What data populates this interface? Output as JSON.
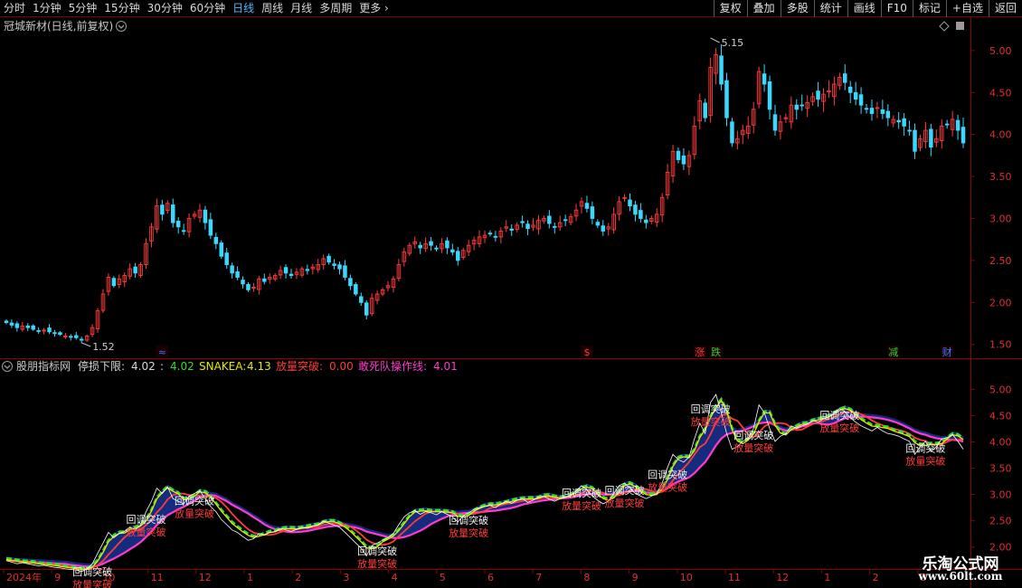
{
  "toolbar": {
    "periods": [
      "分时",
      "1分钟",
      "5分钟",
      "15分钟",
      "30分钟",
      "60分钟",
      "日线",
      "周线",
      "月线",
      "多周期",
      "更多"
    ],
    "active_period": 6,
    "more_arrow": "›",
    "buttons": [
      "复权",
      "叠加",
      "多股",
      "统计",
      "画线",
      "F10",
      "标记",
      "+自选",
      "返回"
    ]
  },
  "main_panel": {
    "title": "冠城新材(日线,前复权)",
    "title_icon": "chevron-down-icon",
    "corner_icons": [
      "diamond-icon",
      "square-icon"
    ],
    "price_ticks": [
      "5.00",
      "4.50",
      "4.00",
      "3.50",
      "3.00",
      "2.50",
      "2.00",
      "1.50"
    ],
    "price_tick_values": [
      5.0,
      4.5,
      4.0,
      3.5,
      3.0,
      2.5,
      2.0,
      1.5
    ],
    "high_label": "5.15",
    "high_index": 131,
    "low_label": "1.52",
    "low_index": 14,
    "markers": [
      {
        "index": 29,
        "text": "≈",
        "color": "#3a7bff"
      },
      {
        "index": 108,
        "text": "$",
        "color": "#ff3b3b"
      },
      {
        "index": 129,
        "text": "涨",
        "color": "#ff3b3b"
      },
      {
        "index": 132,
        "text": "跌",
        "color": "#33cc33"
      },
      {
        "index": 165,
        "text": "减",
        "color": "#33cc33"
      },
      {
        "index": 175,
        "text": "财",
        "color": "#3a7bff"
      }
    ]
  },
  "indicator_panel": {
    "title": "股朋指标网",
    "stop_label": "停损下限:",
    "stop_value": "4.02",
    "val2_label": ":",
    "val2": "4.02",
    "snake_label": "SNAKEA:",
    "snake_value": "4.13",
    "breakout_label": "放量突破:",
    "breakout_value": "0.00",
    "squad_label": "敢死队操作线:",
    "squad_value": "4.01",
    "ticks": [
      "5.00",
      "4.50",
      "4.00",
      "3.50",
      "3.00",
      "2.50",
      "2.00"
    ],
    "tick_values": [
      5.0,
      4.5,
      4.0,
      3.5,
      3.0,
      2.5,
      2.0
    ],
    "text_callback": "回调突破",
    "text_volume": "放量突破"
  },
  "x_axis": {
    "labels": [
      "2024年",
      "9",
      "10",
      "11",
      "12",
      "1",
      "2",
      "3",
      "4",
      "5",
      "6",
      "7",
      "8",
      "9",
      "10",
      "11",
      "12",
      "1",
      "2",
      "3"
    ]
  },
  "watermark": {
    "line1": "乐淘公式网",
    "line2": "www.60lt.com"
  },
  "colors": {
    "up": "#ff3b3b",
    "down": "#38d8ff",
    "border": "#8b0000"
  },
  "chart_data": {
    "type": "candlestick",
    "title": "冠城新材(日线,前复权)",
    "ylim": [
      1.4,
      5.3
    ],
    "period_labels": [
      "2024年",
      "9",
      "10",
      "11",
      "12",
      "1",
      "2",
      "3",
      "4",
      "5",
      "6",
      "7",
      "8",
      "9",
      "10",
      "11",
      "12",
      "1",
      "2",
      "3"
    ],
    "close": [
      1.76,
      1.73,
      1.7,
      1.72,
      1.7,
      1.68,
      1.66,
      1.67,
      1.65,
      1.63,
      1.62,
      1.6,
      1.59,
      1.58,
      1.55,
      1.6,
      1.7,
      1.9,
      2.1,
      2.3,
      2.2,
      2.28,
      2.32,
      2.4,
      2.35,
      2.45,
      2.7,
      2.9,
      3.15,
      3.05,
      3.18,
      2.95,
      2.9,
      2.85,
      3.0,
      3.05,
      3.1,
      2.95,
      2.8,
      2.7,
      2.55,
      2.45,
      2.35,
      2.3,
      2.22,
      2.15,
      2.18,
      2.28,
      2.25,
      2.3,
      2.32,
      2.38,
      2.35,
      2.32,
      2.36,
      2.4,
      2.38,
      2.42,
      2.45,
      2.52,
      2.48,
      2.44,
      2.4,
      2.3,
      2.2,
      2.1,
      2.0,
      1.85,
      2.05,
      2.1,
      2.15,
      2.2,
      2.28,
      2.45,
      2.6,
      2.68,
      2.72,
      2.65,
      2.7,
      2.68,
      2.64,
      2.7,
      2.65,
      2.6,
      2.5,
      2.62,
      2.68,
      2.74,
      2.78,
      2.8,
      2.82,
      2.78,
      2.85,
      2.9,
      2.86,
      2.92,
      2.95,
      2.88,
      2.92,
      2.98,
      3.0,
      2.94,
      2.9,
      2.95,
      2.98,
      3.02,
      3.1,
      3.2,
      3.12,
      3.0,
      2.92,
      2.85,
      2.9,
      3.05,
      3.2,
      3.25,
      3.15,
      3.05,
      3.0,
      2.95,
      3.0,
      3.05,
      3.25,
      3.55,
      3.8,
      3.7,
      3.65,
      3.75,
      4.1,
      4.4,
      4.2,
      4.8,
      4.95,
      4.6,
      4.2,
      3.9,
      3.95,
      4.05,
      4.1,
      4.3,
      4.75,
      4.6,
      4.3,
      4.05,
      4.15,
      4.2,
      4.35,
      4.3,
      4.35,
      4.38,
      4.45,
      4.42,
      4.48,
      4.52,
      4.6,
      4.68,
      4.62,
      4.5,
      4.42,
      4.35,
      4.3,
      4.25,
      4.32,
      4.25,
      4.2,
      4.18,
      4.15,
      4.1,
      4.05,
      3.8,
      3.95,
      4.05,
      3.85,
      3.95,
      4.1,
      4.12,
      4.18,
      4.05,
      3.9
    ],
    "indicator": {
      "stop_lower": 4.02,
      "val2": 4.02,
      "snakea": 4.13,
      "volume_breakout": 0.0,
      "squad_line": 4.01
    }
  }
}
